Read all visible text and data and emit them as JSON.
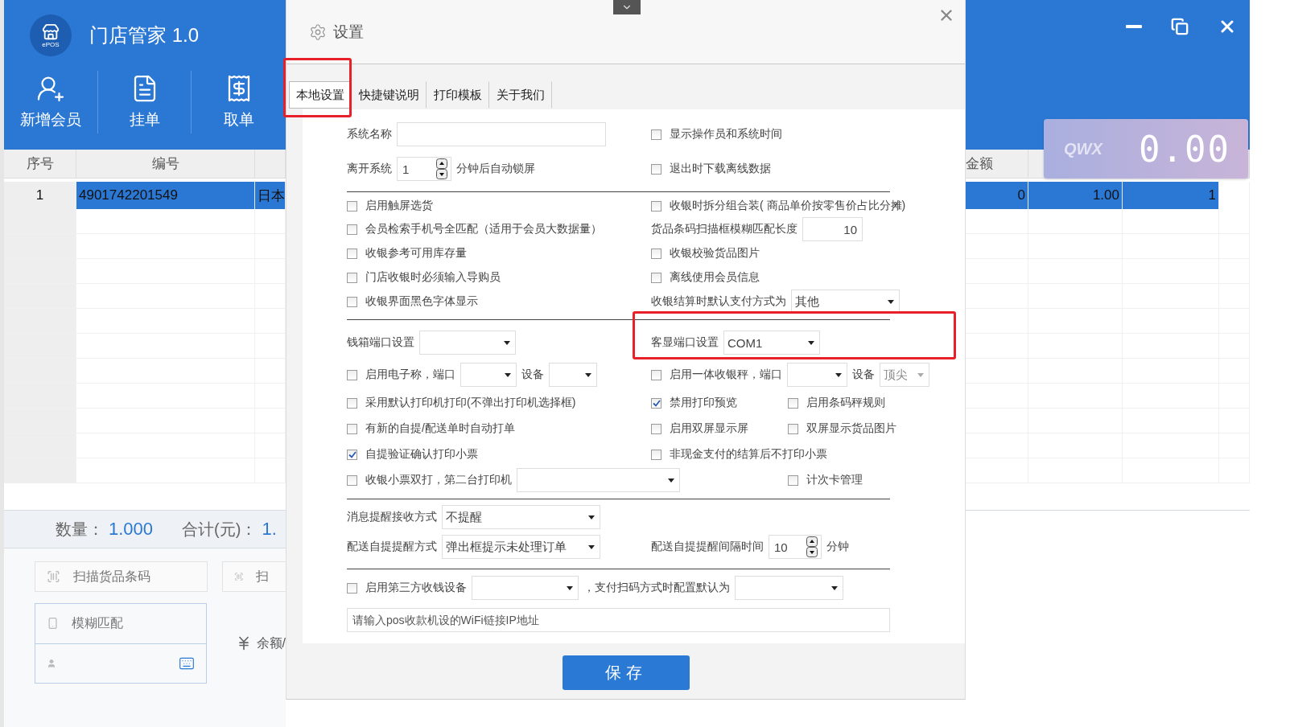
{
  "app": {
    "logo_text": "ePOS",
    "title": "门店管家 1.0",
    "toolbar": [
      {
        "label": "新增会员"
      },
      {
        "label": "挂单"
      },
      {
        "label": "取单"
      }
    ]
  },
  "left_table": {
    "columns": [
      "序号",
      "编号"
    ],
    "rows": [
      {
        "cells": [
          "1",
          "4901742201549",
          "日本"
        ],
        "selected": true
      }
    ]
  },
  "right_table": {
    "columns": [
      "金额"
    ],
    "rows": [
      {
        "cells": [
          "0",
          "1.00",
          "1"
        ],
        "selected": true
      }
    ]
  },
  "display": {
    "brand": "QWX",
    "amount": "0.00"
  },
  "summary": {
    "quantity_label": "数量：",
    "quantity": "1.000",
    "total_label": "合计(元)：",
    "total": "1."
  },
  "lower": {
    "scan_placeholder": "扫描货品条码",
    "scan2_placeholder": "扫",
    "fuzzy_placeholder": "模糊匹配",
    "balance_label": "余额/"
  },
  "dialog": {
    "title": "设置",
    "tabs": [
      {
        "label": "本地设置",
        "selected": true
      },
      {
        "label": "快捷键说明",
        "selected": false
      },
      {
        "label": "打印模板",
        "selected": false
      },
      {
        "label": "关于我们",
        "selected": false
      }
    ],
    "rows": [
      {
        "kind": "fields",
        "left": [
          {
            "kind": "label",
            "text": "系统名称"
          },
          {
            "kind": "input"
          }
        ],
        "middle": [
          {
            "kind": "checkbox",
            "label": "显示操作员和系统时间",
            "checked": false
          }
        ]
      },
      {
        "kind": "fields",
        "left": [
          {
            "kind": "label",
            "text": "离开系统"
          },
          {
            "kind": "spinner",
            "value": "1"
          },
          {
            "kind": "label",
            "text": "分钟后自动锁屏"
          }
        ],
        "middle": [
          {
            "kind": "checkbox",
            "label": "退出时下载离线数据",
            "checked": false
          }
        ]
      },
      {
        "kind": "divider"
      },
      {
        "kind": "fields",
        "left": [
          {
            "kind": "checkbox",
            "label": "启用触屏选货",
            "checked": false
          }
        ],
        "middle": [
          {
            "kind": "checkbox",
            "label": "收银时拆分组合装( 商品单价按零售价占比分摊)",
            "checked": false
          }
        ]
      },
      {
        "kind": "fields",
        "left": [
          {
            "kind": "checkbox",
            "label": "会员检索手机号全匹配（适用于会员大数据量）",
            "checked": false
          }
        ],
        "middle": [
          {
            "kind": "label",
            "text": "货品条码扫描框模糊匹配长度"
          },
          {
            "kind": "input",
            "value": "10"
          }
        ]
      },
      {
        "kind": "fields",
        "left": [
          {
            "kind": "checkbox",
            "label": "收银参考可用库存量",
            "checked": false
          }
        ],
        "middle": [
          {
            "kind": "checkbox",
            "label": "收银校验货品图片",
            "checked": false
          }
        ]
      },
      {
        "kind": "fields",
        "left": [
          {
            "kind": "checkbox",
            "label": "门店收银时必须输入导购员",
            "checked": false
          }
        ],
        "middle": [
          {
            "kind": "checkbox",
            "label": "离线使用会员信息",
            "checked": false
          }
        ]
      },
      {
        "kind": "fields",
        "left": [
          {
            "kind": "checkbox",
            "label": "收银界面黑色字体显示",
            "checked": false
          }
        ],
        "middle": [
          {
            "kind": "label",
            "text": "收银结算时默认支付方式为"
          },
          {
            "kind": "select",
            "value": "其他",
            "disabled": false
          }
        ]
      },
      {
        "kind": "divider"
      },
      {
        "kind": "fields",
        "left": [
          {
            "kind": "label",
            "text": "钱箱端口设置"
          },
          {
            "kind": "select",
            "disabled": false
          }
        ],
        "middle": [
          {
            "kind": "label",
            "text": "客显端口设置"
          },
          {
            "kind": "select",
            "value": "COM1",
            "disabled": false
          }
        ]
      },
      {
        "kind": "fields",
        "left": [
          {
            "kind": "checkbox",
            "label": "启用电子称，端口",
            "checked": false
          },
          {
            "kind": "select",
            "disabled": false
          },
          {
            "kind": "label",
            "text": "设备"
          },
          {
            "kind": "select",
            "disabled": false
          }
        ],
        "middle": [
          {
            "kind": "checkbox",
            "label": "启用一体收银秤，端口",
            "checked": false
          },
          {
            "kind": "select",
            "disabled": false
          },
          {
            "kind": "label",
            "text": "设备"
          },
          {
            "kind": "select",
            "value": "顶尖",
            "disabled": true
          }
        ]
      },
      {
        "kind": "fields",
        "left": [
          {
            "kind": "checkbox",
            "label": "采用默认打印机打印(不弹出打印机选择框)",
            "checked": false
          }
        ],
        "middle": [
          {
            "kind": "checkbox",
            "label": "禁用打印预览",
            "checked": true
          }
        ],
        "right": [
          {
            "kind": "checkbox",
            "label": "启用条码秤规则",
            "checked": false
          }
        ]
      },
      {
        "kind": "fields",
        "left": [
          {
            "kind": "checkbox",
            "label": "有新的自提/配送单时自动打单",
            "checked": false
          }
        ],
        "middle": [
          {
            "kind": "checkbox",
            "label": "启用双屏显示屏",
            "checked": false
          }
        ],
        "right": [
          {
            "kind": "checkbox",
            "label": "双屏显示货品图片",
            "checked": false
          }
        ]
      },
      {
        "kind": "fields",
        "left": [
          {
            "kind": "checkbox",
            "label": "自提验证确认打印小票",
            "checked": true
          }
        ],
        "middle": [
          {
            "kind": "checkbox",
            "label": "非现金支付的结算后不打印小票",
            "checked": false
          }
        ]
      },
      {
        "kind": "fields",
        "left": [
          {
            "kind": "checkbox",
            "label": "收银小票双打，第二台打印机",
            "checked": false
          },
          {
            "kind": "select",
            "disabled": false
          }
        ],
        "right": [
          {
            "kind": "checkbox",
            "label": "计次卡管理",
            "checked": false
          }
        ]
      },
      {
        "kind": "divider"
      },
      {
        "kind": "fields",
        "left": [
          {
            "kind": "label",
            "text": "消息提醒接收方式"
          },
          {
            "kind": "select",
            "value": "不提醒",
            "disabled": false
          }
        ]
      },
      {
        "kind": "fields",
        "left": [
          {
            "kind": "label",
            "text": "配送自提提醒方式"
          },
          {
            "kind": "select",
            "value": "弹出框提示未处理订单",
            "disabled": false
          }
        ],
        "middle": [
          {
            "kind": "label",
            "text": "配送自提提醒间隔时间"
          },
          {
            "kind": "spinner",
            "value": "10"
          },
          {
            "kind": "label",
            "text": "分钟"
          }
        ]
      },
      {
        "kind": "divider"
      },
      {
        "kind": "fields",
        "left": [
          {
            "kind": "checkbox",
            "label": "启用第三方收钱设备",
            "checked": false
          },
          {
            "kind": "select",
            "disabled": false
          },
          {
            "kind": "label",
            "text": "，支付扫码方式时配置默认为"
          },
          {
            "kind": "select",
            "disabled": false
          }
        ]
      },
      {
        "kind": "wide_input",
        "placeholder": "请输入pos收款机设的WiFi链接IP地址"
      }
    ],
    "save_button": "保存"
  }
}
